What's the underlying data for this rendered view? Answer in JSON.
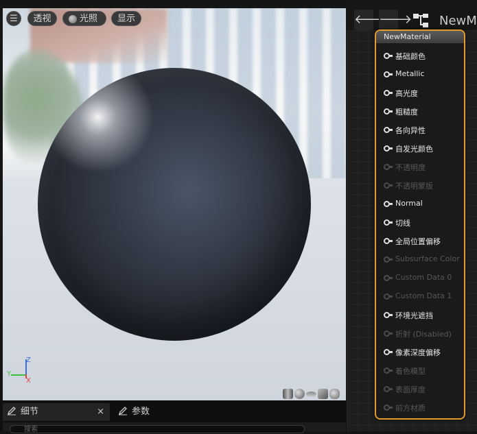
{
  "viewport": {
    "menu_icon": "hamburger-icon",
    "perspective_label": "透视",
    "lighting_label": "光照",
    "show_label": "显示",
    "axis": {
      "z": "Z",
      "y": "Y",
      "x": "X"
    },
    "preview_shapes": [
      "cylinder-icon",
      "sphere-icon",
      "plane-icon",
      "cube-icon",
      "teapot-icon"
    ]
  },
  "tabs": {
    "details_label": "细节",
    "params_label": "参数",
    "close": "×",
    "search_placeholder": "搜索"
  },
  "graph": {
    "title": "NewM",
    "back_icon": "arrow-left-icon",
    "forward_icon": "arrow-right-icon",
    "node": {
      "name": "NewMaterial",
      "pins": [
        {
          "label": "基础颜色",
          "enabled": true
        },
        {
          "label": "Metallic",
          "enabled": true
        },
        {
          "label": "高光度",
          "enabled": true
        },
        {
          "label": "粗糙度",
          "enabled": true
        },
        {
          "label": "各向异性",
          "enabled": true
        },
        {
          "label": "自发光颜色",
          "enabled": true
        },
        {
          "label": "不透明度",
          "enabled": false
        },
        {
          "label": "不透明蒙版",
          "enabled": false
        },
        {
          "label": "Normal",
          "enabled": true
        },
        {
          "label": "切线",
          "enabled": true
        },
        {
          "label": "全局位置偏移",
          "enabled": true
        },
        {
          "label": "Subsurface Color",
          "enabled": false
        },
        {
          "label": "Custom Data 0",
          "enabled": false
        },
        {
          "label": "Custom Data 1",
          "enabled": false
        },
        {
          "label": "环境光遮挡",
          "enabled": true
        },
        {
          "label": "折射 (Disabled)",
          "enabled": false
        },
        {
          "label": "像素深度偏移",
          "enabled": true
        },
        {
          "label": "着色模型",
          "enabled": false
        },
        {
          "label": "表面厚度",
          "enabled": false
        },
        {
          "label": "前方材质",
          "enabled": false
        }
      ]
    }
  },
  "colors": {
    "accent": "#e49a28",
    "pin_enabled": "#e0e0e0",
    "pin_disabled": "#4c4c4c"
  }
}
